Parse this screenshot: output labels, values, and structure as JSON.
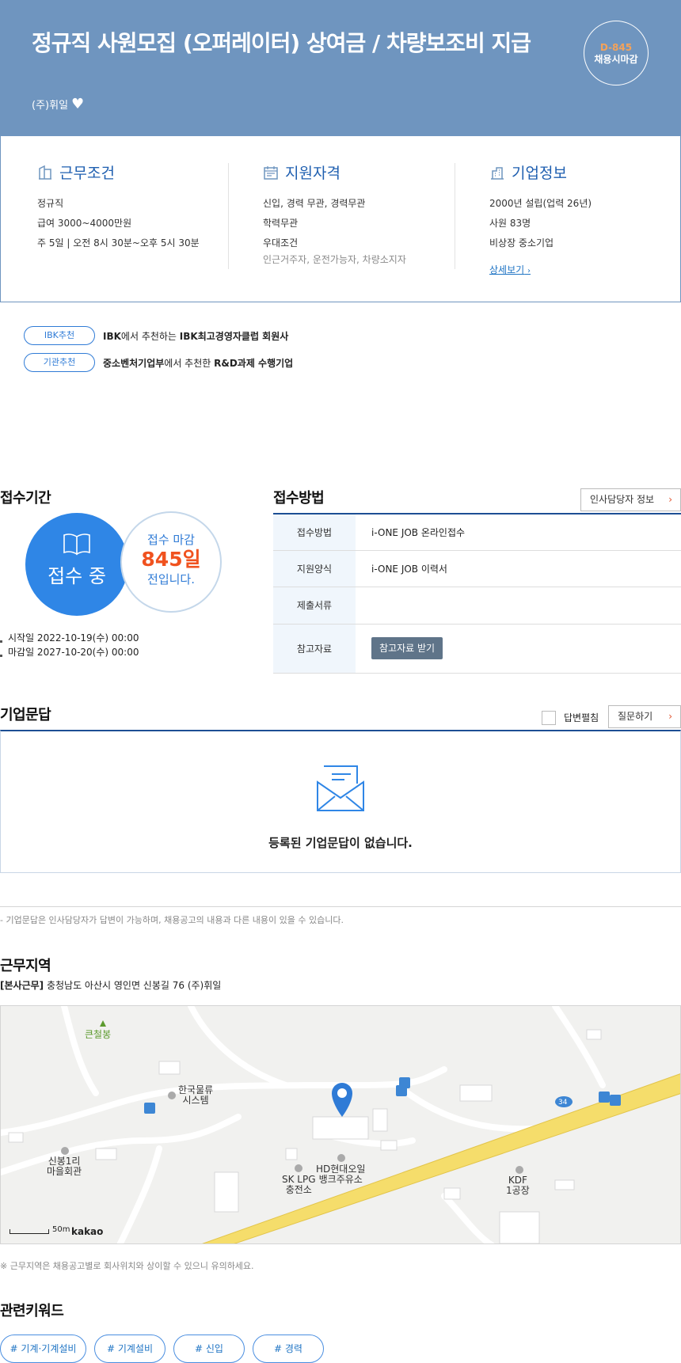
{
  "header": {
    "title": "정규직 사원모집 (오퍼레이터) 상여금 / 차량보조비 지급",
    "company": "(주)휘일",
    "dday": "D-845",
    "dday_status": "채용시마감"
  },
  "info": {
    "work": {
      "title": "근무조건",
      "lines": [
        "정규직",
        "급여 3000~4000만원",
        "주 5일 | 오전 8시 30분~오후 5시 30분"
      ]
    },
    "qual": {
      "title": "지원자격",
      "lines": [
        "신입, 경력 무관, 경력무관",
        "학력무관",
        "우대조건"
      ],
      "sub": "인근거주자, 운전가능자, 차량소지자"
    },
    "company": {
      "title": "기업정보",
      "lines": [
        "2000년 설립(업력 26년)",
        "사원 83명",
        "비상장 중소기업"
      ],
      "detail_link": "상세보기"
    }
  },
  "recommend": [
    {
      "tag": "IBK추천",
      "pre": "IBK",
      "mid": "에서 추천하는 ",
      "strong": "IBK최고경영자클럽 회원사"
    },
    {
      "tag": "기관추천",
      "pre": "중소벤처기업부",
      "mid": "에서 추천한 ",
      "strong": "R&D과제 수행기업"
    }
  ],
  "period": {
    "title": "접수기간",
    "status": "접수 중",
    "deadline_pre": "접수 마감",
    "deadline_days": "845일",
    "deadline_post": "전입니다.",
    "start": "시작일 2022-10-19(수) 00:00",
    "end": "마감일 2027-10-20(수) 00:00"
  },
  "method": {
    "title": "접수방법",
    "hr_button": "인사담당자 정보",
    "rows": [
      {
        "label": "접수방법",
        "value": "i-ONE JOB 온라인접수"
      },
      {
        "label": "지원양식",
        "value": "i-ONE JOB 이력서"
      },
      {
        "label": "제출서류",
        "value": ""
      },
      {
        "label": "참고자료",
        "value": "참고자료 받기"
      }
    ]
  },
  "qa": {
    "title": "기업문답",
    "toggle_label": "답변펼침",
    "ask_button": "질문하기",
    "empty": "등록된 기업문답이 없습니다.",
    "note": "- 기업문답은 인사담당자가 답변이 가능하며, 채용공고의 내용과 다른 내용이 있을 수 있습니다."
  },
  "location": {
    "title": "근무지역",
    "addr_tag": "[본사근무]",
    "addr": " 충청남도 아산시 영인면 신봉길 76 (주)휘일",
    "map_labels": {
      "peak": "큰철봉",
      "logistics": "한국물류\n시스템",
      "village": "신봉1리\n마을회관",
      "gas": "HD현대오일\n뱅크주유소",
      "lpg": "SK LPG\n충전소",
      "kdf": "KDF\n1공장",
      "route": "34"
    },
    "scale": "50m",
    "provider": "kakao",
    "note": "※ 근무지역은 채용공고별로 회사위치와 상이할 수 있으니 유의하세요."
  },
  "keywords": {
    "title": "관련키워드",
    "items": [
      "# 기계·기계설비",
      "# 기계설비",
      "# 신입",
      "# 경력"
    ]
  },
  "colors": {
    "header_bg": "#6f95bf",
    "accent": "#2f86e6",
    "deadline": "#f0521f",
    "dday": "#f3a25a"
  }
}
